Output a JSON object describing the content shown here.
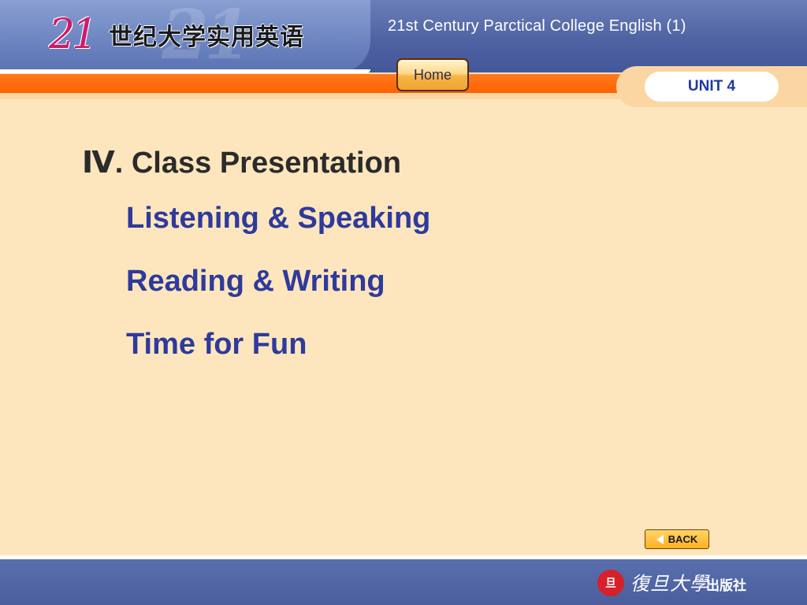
{
  "header": {
    "logo_number": "21",
    "logo_text": "世纪大学实用英语",
    "watermark": "21",
    "course_title": "21st Century Parctical College English  (1)",
    "home_label": "Home",
    "unit_label": "UNIT 4"
  },
  "content": {
    "section_title": "Ⅳ. Class Presentation",
    "menu_items": [
      {
        "label": "Listening & Speaking"
      },
      {
        "label": "Reading & Writing"
      },
      {
        "label": "Time for Fun"
      }
    ]
  },
  "navigation": {
    "back_label": "BACK",
    "back_icon": "left-triangle-arrow"
  },
  "footer": {
    "publisher_seal": "旦",
    "publisher_name": "復旦大學",
    "publisher_suffix": "出版社"
  },
  "colors": {
    "header_blue": "#4f63a3",
    "orange_bar": "#ff6a00",
    "background": "#fde6bd",
    "link_blue": "#2e3a9c",
    "unit_text": "#1e3aa0"
  }
}
